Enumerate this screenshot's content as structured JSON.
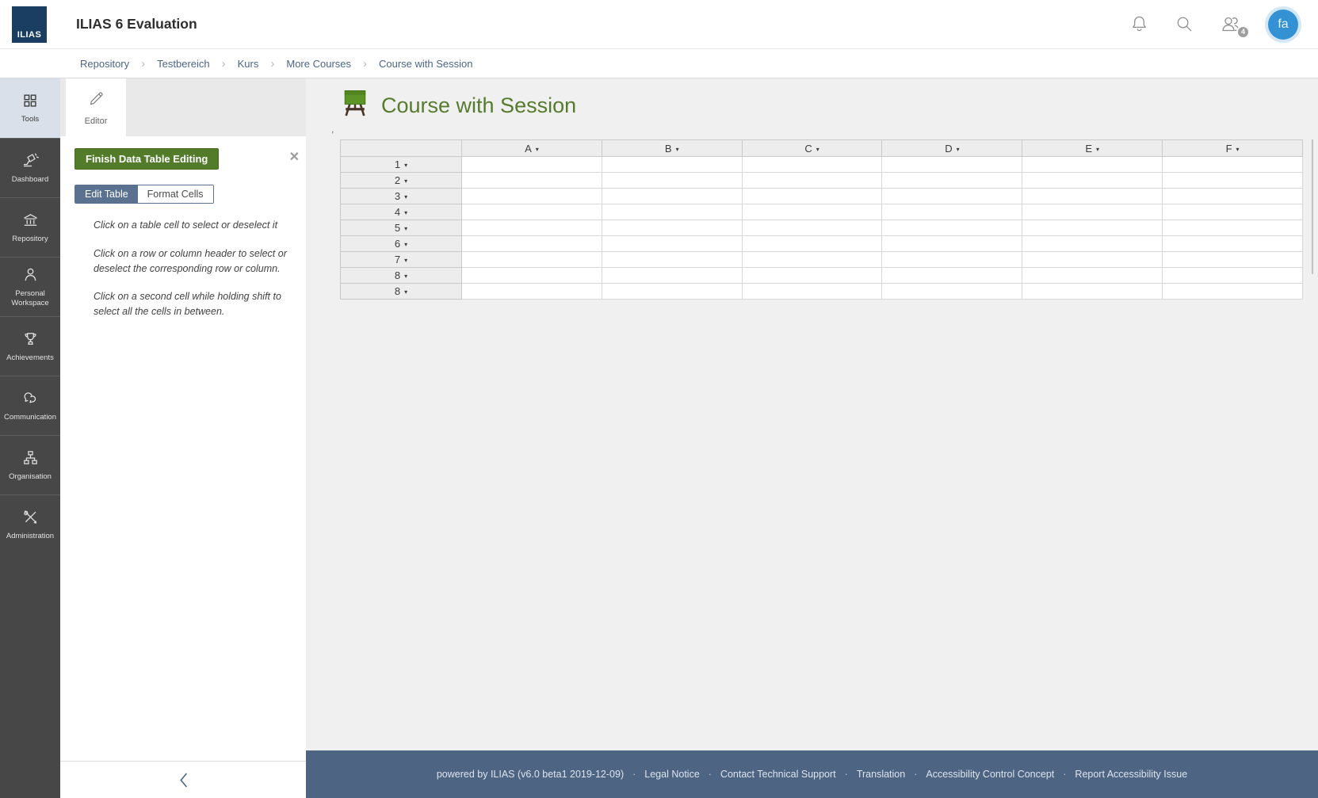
{
  "colors": {
    "brand_navy": "#1a3e61",
    "accent_green": "#527c29",
    "title_green": "#567b2e",
    "link_blue": "#4c6586",
    "toggle_active": "#5b7190",
    "footer_navy": "#4d6482",
    "avatar_blue": "#3391d4",
    "sidebar_dark": "#474747",
    "sidebar_active": "#d9e0e9"
  },
  "header": {
    "logo_text": "ILIAS",
    "title": "ILIAS 6 Evaluation",
    "notification_badge": "4",
    "avatar_initials": "fa",
    "icons": [
      "bell-icon",
      "search-icon",
      "users-icon"
    ]
  },
  "breadcrumb": {
    "separator": "›",
    "items": [
      "Repository",
      "Testbereich",
      "Kurs",
      "More Courses",
      "Course with Session"
    ]
  },
  "sidebar": {
    "items": [
      {
        "label": "Tools",
        "icon": "grid-icon",
        "active": true
      },
      {
        "label": "Dashboard",
        "icon": "lamp-icon",
        "active": false
      },
      {
        "label": "Repository",
        "icon": "bank-icon",
        "active": false
      },
      {
        "label": "Personal Workspace",
        "icon": "person-icon",
        "active": false
      },
      {
        "label": "Achievements",
        "icon": "trophy-icon",
        "active": false
      },
      {
        "label": "Communication",
        "icon": "chat-icon",
        "active": false
      },
      {
        "label": "Organisation",
        "icon": "orgchart-icon",
        "active": false
      },
      {
        "label": "Administration",
        "icon": "tools-icon",
        "active": false
      }
    ]
  },
  "tools_panel": {
    "tab_label": "Editor",
    "tab_icon": "pencil-icon",
    "finish_button_label": "Finish Data Table Editing",
    "close_symbol": "✕",
    "tabs": [
      {
        "label": "Edit Table",
        "active": true
      },
      {
        "label": "Format Cells",
        "active": false
      }
    ],
    "instructions": [
      "Click on a table cell to select or deselect it",
      "Click on a row or column header to select or deselect the corresponding row or column.",
      "Click on a second cell while holding shift to select all the cells in between."
    ]
  },
  "main": {
    "page_title": "Course with Session",
    "page_icon": "course-easel-icon",
    "stray_mark": ",",
    "table": {
      "caret": "▾",
      "columns": [
        "A",
        "B",
        "C",
        "D",
        "E",
        "F"
      ],
      "row_labels": [
        "1",
        "2",
        "3",
        "4",
        "5",
        "6",
        "7",
        "8",
        "8"
      ],
      "cells": [
        [
          "",
          "",
          "",
          "",
          "",
          ""
        ],
        [
          "",
          "",
          "",
          "",
          "",
          ""
        ],
        [
          "",
          "",
          "",
          "",
          "",
          ""
        ],
        [
          "",
          "",
          "",
          "",
          "",
          ""
        ],
        [
          "",
          "",
          "",
          "",
          "",
          ""
        ],
        [
          "",
          "",
          "",
          "",
          "",
          ""
        ],
        [
          "",
          "",
          "",
          "",
          "",
          ""
        ],
        [
          "",
          "",
          "",
          "",
          "",
          ""
        ],
        [
          "",
          "",
          "",
          "",
          "",
          ""
        ]
      ]
    }
  },
  "footer": {
    "powered_by": "powered by ILIAS (v6.0 beta1 2019-12-09)",
    "separator": "·",
    "links": [
      "Legal Notice",
      "Contact Technical Support",
      "Translation",
      "Accessibility Control Concept",
      "Report Accessibility Issue"
    ]
  }
}
